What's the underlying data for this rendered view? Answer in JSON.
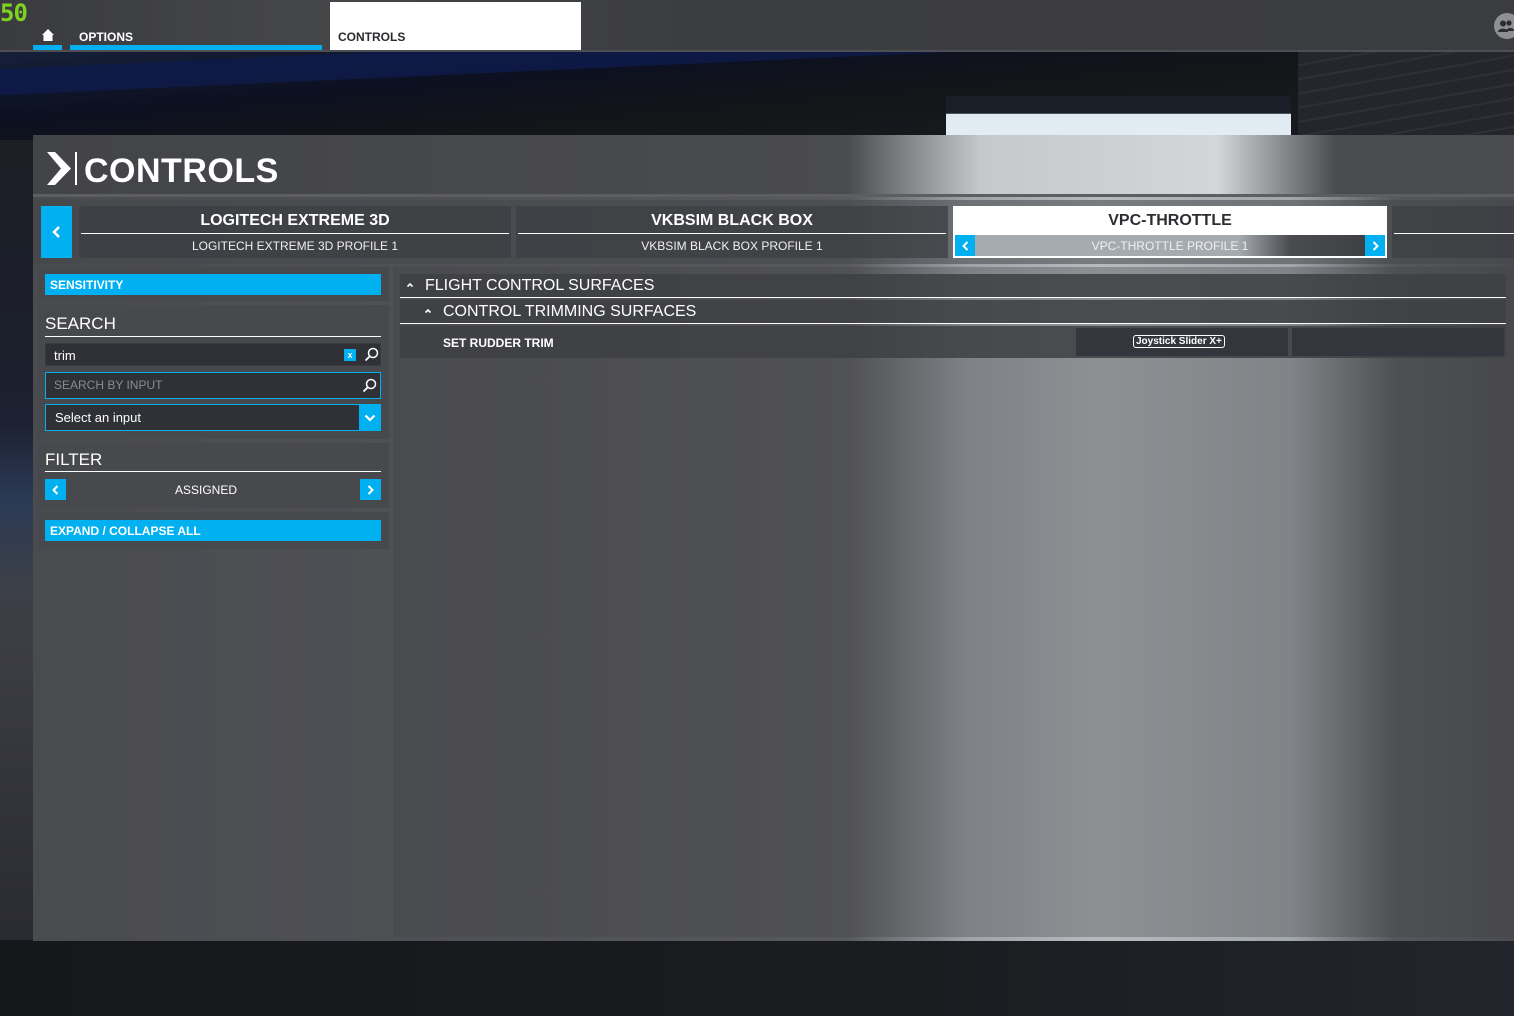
{
  "overlay": {
    "fps_counter": "50"
  },
  "topbar": {
    "home_icon": "home-icon",
    "breadcrumbs": [
      {
        "label": "OPTIONS",
        "active": false
      },
      {
        "label": "CONTROLS",
        "active": true
      }
    ],
    "profile_icon": "users-icon"
  },
  "panel": {
    "title": "CONTROLS",
    "title_icon": "chevron-right-icon"
  },
  "devices": {
    "prev_icon": "chevron-left-icon",
    "items": [
      {
        "name": "LOGITECH EXTREME 3D",
        "profile": "LOGITECH EXTREME 3D PROFILE 1",
        "active": false
      },
      {
        "name": "VKBSIM BLACK BOX",
        "profile": "VKBSIM BLACK BOX PROFILE 1",
        "active": false
      },
      {
        "name": "VPC-THROTTLE",
        "profile": "VPC-THROTTLE PROFILE 1",
        "active": true
      }
    ]
  },
  "sidebar": {
    "sensitivity_label": "SENSITIVITY",
    "search": {
      "title": "SEARCH",
      "query_value": "trim",
      "clear_label": "x",
      "input_search_placeholder": "SEARCH BY INPUT",
      "input_select_value": "Select an input"
    },
    "filter": {
      "title": "FILTER",
      "value": "ASSIGNED"
    },
    "expand_collapse_label": "EXPAND / COLLAPSE ALL"
  },
  "bindings": {
    "categories": [
      {
        "label": "FLIGHT CONTROL SURFACES",
        "expanded": true,
        "subcategories": [
          {
            "label": "CONTROL TRIMMING SURFACES",
            "expanded": true,
            "actions": [
              {
                "label": "SET RUDDER TRIM",
                "primary_input": "Joystick Slider X+",
                "secondary_input": ""
              }
            ]
          }
        ]
      }
    ]
  },
  "colors": {
    "accent": "#00b0f0",
    "fps_green": "#7ed321",
    "panel_dark": "#48494d",
    "field_bg": "#2f3136"
  }
}
